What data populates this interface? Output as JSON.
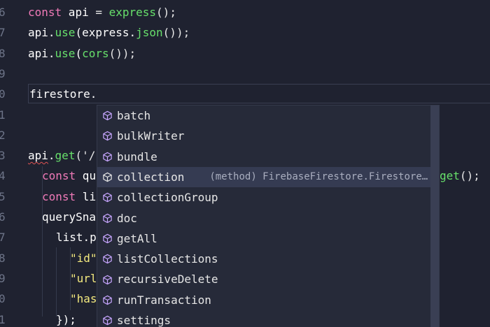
{
  "line_numbers": [
    "6",
    "7",
    "8",
    "9",
    "0",
    "1",
    "2",
    "3",
    "4",
    "5",
    "6",
    "7",
    "8",
    "9",
    "0",
    "1"
  ],
  "code": {
    "l1": {
      "kw": "const",
      "id": " api ",
      "op": "= ",
      "fn": "express",
      "rest": "();"
    },
    "l2": {
      "a": "api.",
      "fn1": "use",
      "b": "(express.",
      "fn2": "json",
      "c": "());"
    },
    "l3": {
      "a": "api.",
      "fn1": "use",
      "b": "(",
      "fn2": "cors",
      "c": "());"
    },
    "l5": {
      "text": "firestore."
    },
    "l8": {
      "a": "api",
      "b": ".",
      "fn": "get",
      "c": "('/"
    },
    "l9": {
      "kw": "const",
      "rest": " qu",
      "fn": "get",
      "end": "();"
    },
    "l10": {
      "kw": "const",
      "rest": " li"
    },
    "l11": {
      "text": "querySna"
    },
    "l12": {
      "text": "list.p"
    },
    "l13": {
      "str": "\"id\""
    },
    "l14": {
      "str": "\"url"
    },
    "l15": {
      "str": "\"has"
    },
    "l16": {
      "text": "});"
    }
  },
  "suggest": {
    "items": [
      {
        "label": "batch"
      },
      {
        "label": "bulkWriter"
      },
      {
        "label": "bundle"
      },
      {
        "label": "collection",
        "detail": "(method) FirebaseFirestore.Firestore…"
      },
      {
        "label": "collectionGroup"
      },
      {
        "label": "doc"
      },
      {
        "label": "getAll"
      },
      {
        "label": "listCollections"
      },
      {
        "label": "recursiveDelete"
      },
      {
        "label": "runTransaction"
      },
      {
        "label": "settings"
      }
    ],
    "selected_index": 3,
    "icon": "method-cube-icon"
  },
  "colors": {
    "background": "#1f2230",
    "keyword": "#f07ab8",
    "function": "#67e06b",
    "string": "#f3e97f",
    "selection": "#353b52"
  }
}
